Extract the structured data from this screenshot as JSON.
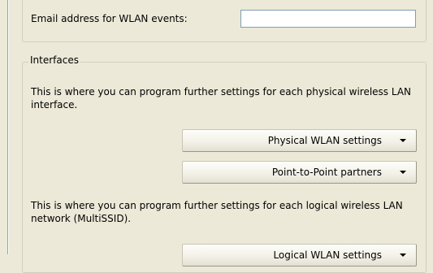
{
  "email": {
    "label": "Email address for WLAN events:",
    "value": ""
  },
  "interfaces": {
    "legend": "Interfaces",
    "physical_description": "This is where you can program further settings for each physical wireless LAN interface.",
    "physical_button": "Physical WLAN settings",
    "p2p_button": "Point-to-Point partners",
    "logical_description": "This is where you can program further settings for each logical wireless LAN network (MultiSSID).",
    "logical_button": "Logical WLAN settings"
  },
  "icons": {
    "dropdown": "chevron-down-icon"
  }
}
